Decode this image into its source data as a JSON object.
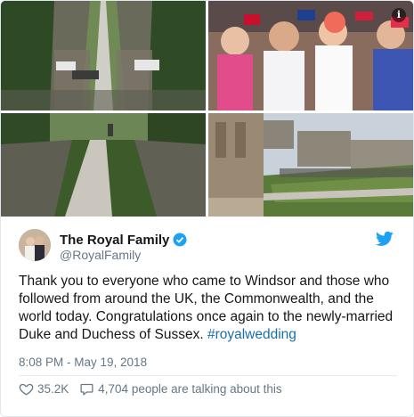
{
  "tweet": {
    "display_name": "The Royal Family",
    "handle": "@RoyalFamily",
    "text_main": "Thank you to everyone who came to Windsor and those who followed from around the UK, the Commonwealth, and the world today. Congratulations once again to the newly-married Duke and Duchess of Sussex. ",
    "hashtag": "#royalwedding",
    "timestamp": "8:08 PM - May 19, 2018",
    "likes": "35.2K",
    "talking": "4,704 people are talking about this"
  },
  "icons": {
    "info": "info-icon",
    "verified": "verified-badge-icon",
    "brand": "twitter-bird-icon",
    "like": "heart-icon",
    "reply": "speech-bubble-icon"
  },
  "colors": {
    "text": "#14171a",
    "muted": "#657786",
    "link": "#1b6fa8",
    "brand": "#1da1f2",
    "border": "#e1e8ed"
  },
  "info_glyph": "i"
}
